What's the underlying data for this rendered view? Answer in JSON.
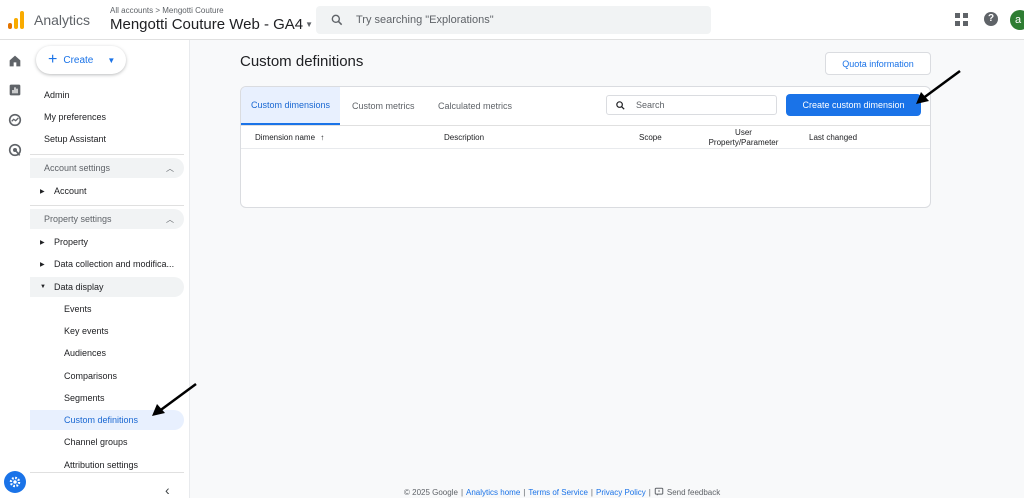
{
  "topbar": {
    "app_name": "Analytics",
    "breadcrumb": "All accounts > Mengotti Couture",
    "property": "Mengotti Couture Web - GA4",
    "search_placeholder": "Try searching \"Explorations\"",
    "avatar_letter": "a"
  },
  "nav": {
    "create_label": "Create",
    "top_items": [
      "Admin",
      "My preferences",
      "Setup Assistant"
    ],
    "account_section": "Account settings",
    "account_item": "Account",
    "property_section": "Property settings",
    "property_item": "Property",
    "data_collection_item": "Data collection and modifica...",
    "data_display_item": "Data display",
    "data_display_children": [
      "Events",
      "Key events",
      "Audiences",
      "Comparisons",
      "Segments",
      "Custom definitions",
      "Channel groups",
      "Attribution settings"
    ]
  },
  "main": {
    "title": "Custom definitions",
    "quota_button": "Quota information",
    "tabs": [
      "Custom dimensions",
      "Custom metrics",
      "Calculated metrics"
    ],
    "active_tab": "Custom dimensions",
    "search_placeholder": "Search",
    "create_button": "Create custom dimension",
    "columns": [
      "Dimension name",
      "Description",
      "Scope",
      "User Property/Parameter",
      "Last changed"
    ],
    "sort_indicator": "↑"
  },
  "footer": {
    "copyright": "© 2025 Google",
    "links": [
      "Analytics home",
      "Terms of Service",
      "Privacy Policy"
    ],
    "feedback": "Send feedback"
  },
  "colors": {
    "accent": "#1a73e8",
    "active_bg": "#e8f0fe",
    "logo_orange": "#f9ab00",
    "logo_dark_orange": "#e37400"
  }
}
